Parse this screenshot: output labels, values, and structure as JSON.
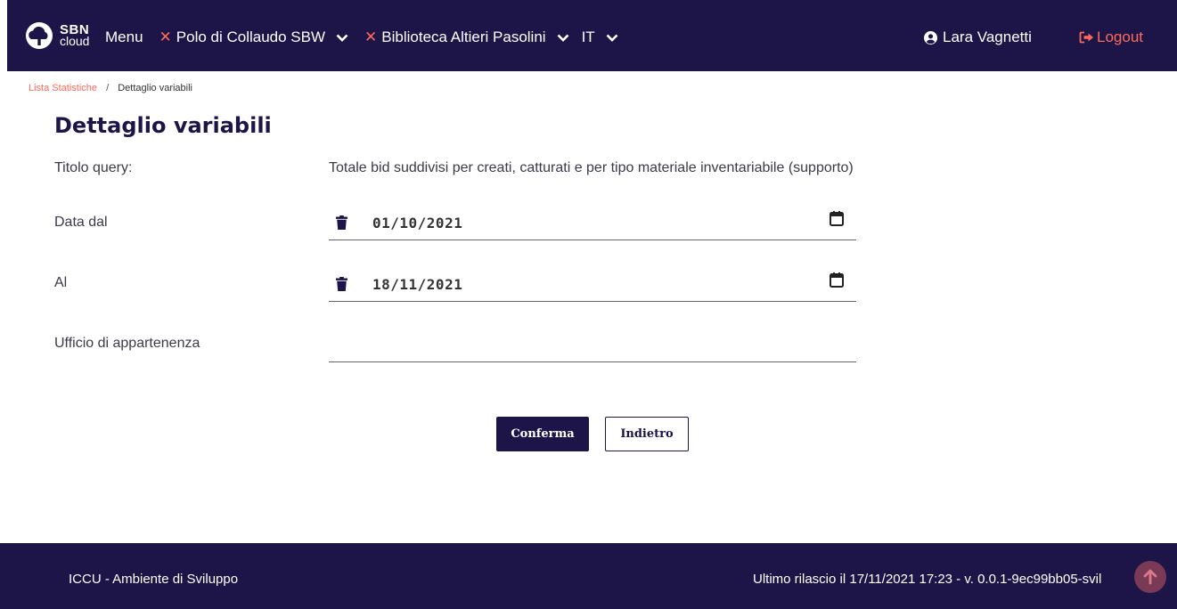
{
  "header": {
    "logo_line1": "SBN",
    "logo_line2": "cloud",
    "menu_label": "Menu",
    "polo_label": "Polo di Collaudo SBW",
    "biblioteca_label": "Biblioteca Altieri Pasolini",
    "language_label": "IT",
    "user_name": "Lara Vagnetti",
    "logout_label": "Logout",
    "accent_color": "#ff6b5a",
    "bg_color": "#1d1548"
  },
  "breadcrumb": {
    "parent": "Lista Statistiche",
    "separator": "/",
    "current": "Dettaglio variabili"
  },
  "page": {
    "title": "Dettaglio variabili"
  },
  "form": {
    "titolo_label": "Titolo query:",
    "titolo_value": "Totale bid suddivisi per creati, catturati e per tipo materiale inventariabile (supporto)",
    "data_dal_label": "Data dal",
    "data_dal_value": "01/10/2021",
    "al_label": "Al",
    "al_value": "18/11/2021",
    "ufficio_label": "Ufficio di appartenenza",
    "ufficio_value": ""
  },
  "actions": {
    "confirm_label": "Conferma",
    "back_label": "Indietro"
  },
  "footer": {
    "environment": "ICCU - Ambiente di Sviluppo",
    "release": "Ultimo rilascio il 17/11/2021 17:23 - v. 0.0.1-9ec99bb05-svil"
  }
}
